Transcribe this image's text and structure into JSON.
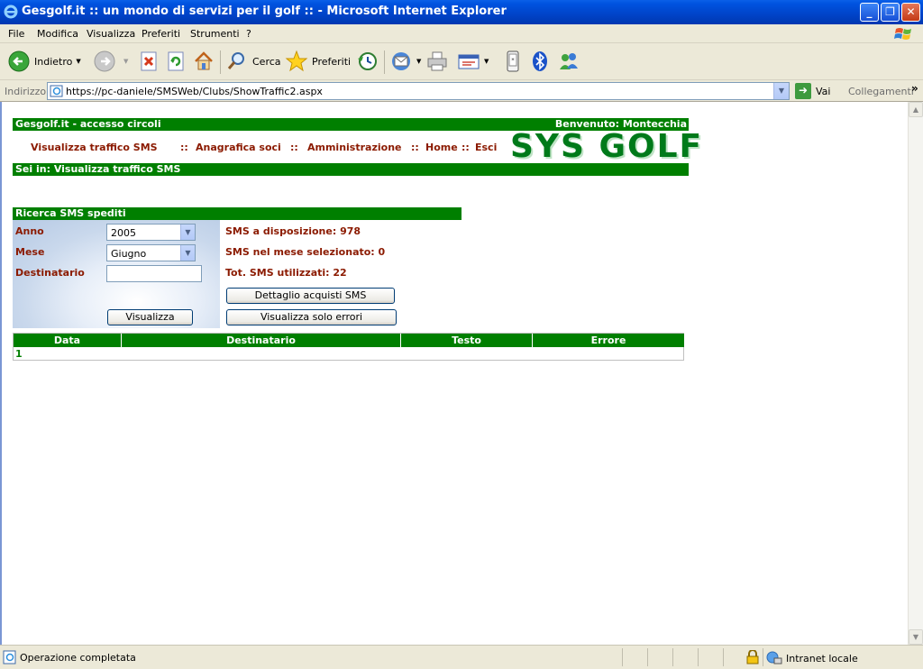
{
  "window": {
    "title": "Gesgolf.it :: un mondo di servizi per il golf :: - Microsoft Internet Explorer"
  },
  "menubar": {
    "items": [
      "File",
      "Modifica",
      "Visualizza",
      "Preferiti",
      "Strumenti",
      "?"
    ]
  },
  "toolbar": {
    "back_label": "Indietro",
    "search_label": "Cerca",
    "favorites_label": "Preferiti"
  },
  "addressbar": {
    "label": "Indirizzo",
    "url": "https://pc-daniele/SMSWeb/Clubs/ShowTraffic2.aspx",
    "go_label": "Vai",
    "links_label": "Collegamenti"
  },
  "header": {
    "site_label": "Gesgolf.it - accesso circoli",
    "welcome": "Benvenuto: Montecchia",
    "breadcrumb": "Sei in: Visualizza traffico SMS",
    "logo_text": "SYS GOLF"
  },
  "nav": {
    "traffic": "Visualizza traffico SMS",
    "sep1": "::",
    "members": "Anagrafica soci",
    "sep2": "::",
    "admin": "Amministrazione",
    "sep3": "::",
    "home": "Home",
    "sep4": "::",
    "exit": "Esci"
  },
  "search": {
    "title": "Ricerca SMS spediti",
    "year_label": "Anno",
    "year_value": "2005",
    "month_label": "Mese",
    "month_value": "Giugno",
    "recipient_label": "Destinatario",
    "recipient_value": "",
    "view_button": "Visualizza"
  },
  "stats": {
    "available": "SMS a disposizione: 978",
    "month": "SMS nel mese selezionato: 0",
    "total": "Tot. SMS utilizzati: 22",
    "purchases_button": "Dettaglio acquisti SMS",
    "errors_button": "Visualizza solo errori"
  },
  "results": {
    "columns": [
      "Data",
      "Destinatario",
      "Testo",
      "Errore"
    ],
    "pager": "1"
  },
  "status": {
    "text": "Operazione completata",
    "zone": "Intranet locale"
  },
  "colors": {
    "green": "#007f00",
    "link": "#8b1a00",
    "xp_blue": "#0043c8"
  }
}
